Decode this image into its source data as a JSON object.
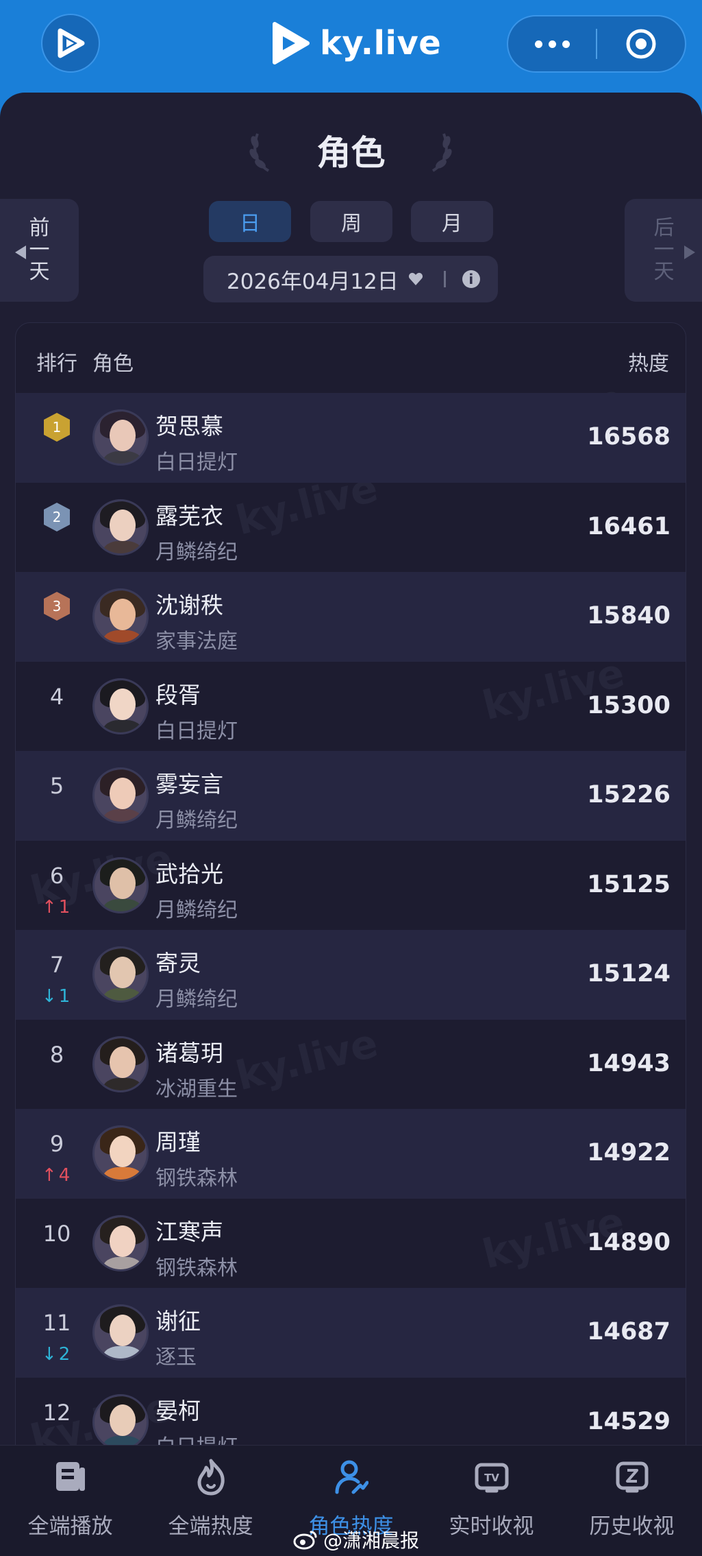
{
  "app": {
    "brand_name": "ky.live"
  },
  "header": {
    "title": "角色"
  },
  "nav": {
    "prev_day_label": "前一天",
    "next_day_label": "后一天",
    "periods": [
      {
        "label": "日",
        "active": true
      },
      {
        "label": "周",
        "active": false
      },
      {
        "label": "月",
        "active": false
      }
    ],
    "date": "2026年04月12日"
  },
  "table": {
    "headers": {
      "rank": "排行",
      "character": "角色",
      "heat": "热度"
    },
    "rows": [
      {
        "rank": "1",
        "medal": "gold",
        "name": "贺思慕",
        "show": "白日提灯",
        "heat": "16568",
        "delta": ""
      },
      {
        "rank": "2",
        "medal": "silver",
        "name": "露芜衣",
        "show": "月鳞绮纪",
        "heat": "16461",
        "delta": ""
      },
      {
        "rank": "3",
        "medal": "bronze",
        "name": "沈谢秩",
        "show": "家事法庭",
        "heat": "15840",
        "delta": ""
      },
      {
        "rank": "4",
        "name": "段胥",
        "show": "白日提灯",
        "heat": "15300",
        "delta": ""
      },
      {
        "rank": "5",
        "name": "雾妄言",
        "show": "月鳞绮纪",
        "heat": "15226",
        "delta": ""
      },
      {
        "rank": "6",
        "name": "武拾光",
        "show": "月鳞绮纪",
        "heat": "15125",
        "delta": "1",
        "direction": "up"
      },
      {
        "rank": "7",
        "name": "寄灵",
        "show": "月鳞绮纪",
        "heat": "15124",
        "delta": "1",
        "direction": "down"
      },
      {
        "rank": "8",
        "name": "诸葛玥",
        "show": "冰湖重生",
        "heat": "14943",
        "delta": ""
      },
      {
        "rank": "9",
        "name": "周瑾",
        "show": "钢铁森林",
        "heat": "14922",
        "delta": "4",
        "direction": "up"
      },
      {
        "rank": "10",
        "name": "江寒声",
        "show": "钢铁森林",
        "heat": "14890",
        "delta": ""
      },
      {
        "rank": "11",
        "name": "谢征",
        "show": "逐玉",
        "heat": "14687",
        "delta": "2",
        "direction": "down"
      },
      {
        "rank": "12",
        "name": "晏柯",
        "show": "白日提灯",
        "heat": "14529",
        "delta": ""
      }
    ]
  },
  "tabbar": {
    "tabs": [
      {
        "label": "全端播放",
        "icon": "playlist-icon",
        "active": false
      },
      {
        "label": "全端热度",
        "icon": "flame-icon",
        "active": false
      },
      {
        "label": "角色热度",
        "icon": "user-trend-icon",
        "active": true
      },
      {
        "label": "实时收视",
        "icon": "tv-icon",
        "active": false
      },
      {
        "label": "历史收视",
        "icon": "history-icon",
        "active": false
      }
    ]
  },
  "watermark": {
    "text": "@潇湘晨报"
  },
  "colors": {
    "brand_blue": "#1a7fd8",
    "panel_bg": "#1f1e33",
    "accent": "#3d90e6",
    "gold": "#c9a232",
    "silver": "#7b93b4",
    "bronze": "#b77358",
    "rank_up": "#e0505e",
    "rank_down": "#2eb3d6"
  }
}
